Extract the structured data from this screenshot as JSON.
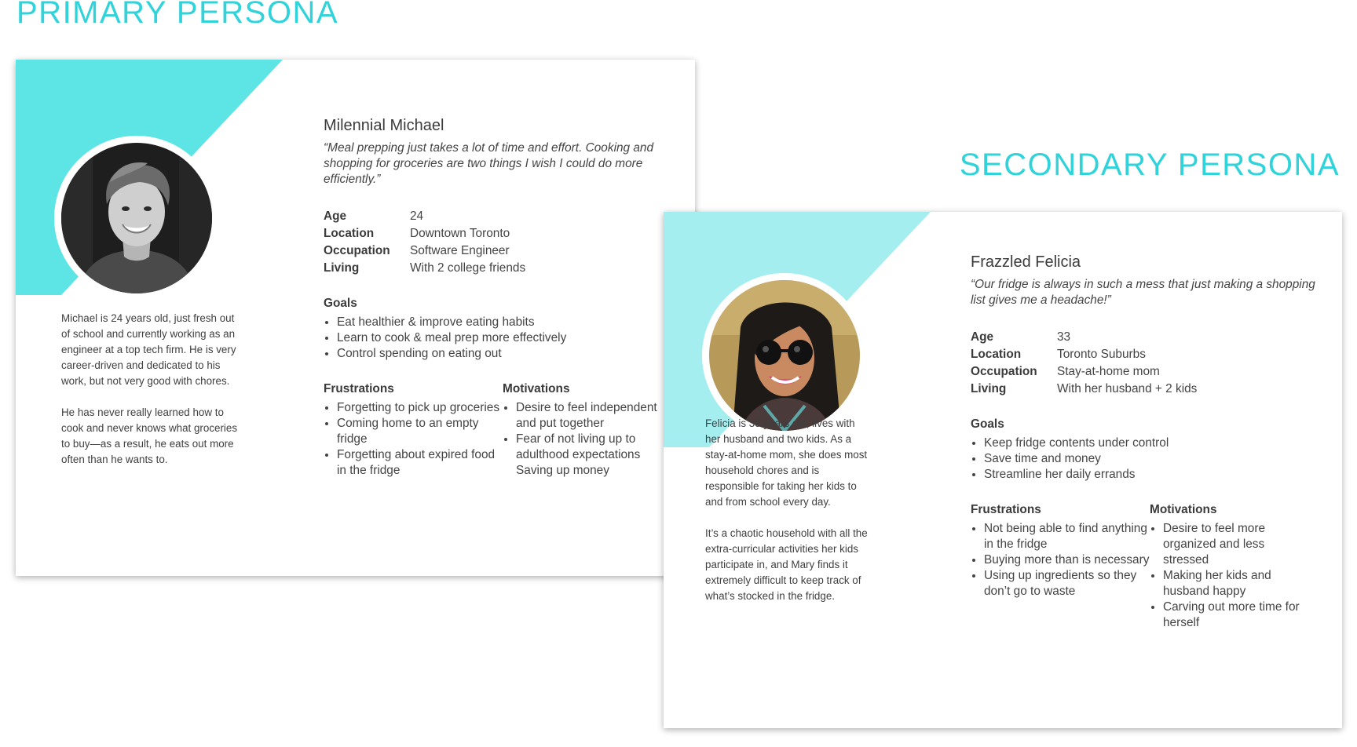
{
  "primary_title": "PRIMARY PERSONA",
  "secondary_title": "SECONDARY PERSONA",
  "colors": {
    "accent": "#2fd3d9",
    "primary_shape": "#5de4e4",
    "secondary_shape": "#a4eef0"
  },
  "primary": {
    "name": "Milennial Michael",
    "quote": "“Meal prepping just takes a lot of time and effort. Cooking and shopping for groceries are two things I wish I could do more efficiently.”",
    "bio": [
      "Michael is 24 years old, just fresh out of school and currently working as an engineer at a top tech firm. He is very career-driven and dedicated to his work, but not very good with chores.",
      "He has never really learned how to cook and never knows what groceries to buy—as a result, he eats out more often than he wants to."
    ],
    "facts": [
      {
        "label": "Age",
        "value": "24"
      },
      {
        "label": "Location",
        "value": "Downtown Toronto"
      },
      {
        "label": "Occupation",
        "value": "Software Engineer"
      },
      {
        "label": "Living",
        "value": "With 2 college friends"
      }
    ],
    "goals_heading": "Goals",
    "goals": [
      "Eat healthier & improve eating habits",
      "Learn to cook & meal prep more effectively",
      "Control spending on eating out"
    ],
    "frustrations_heading": "Frustrations",
    "frustrations": [
      "Forgetting to pick up groceries",
      "Coming home to an empty fridge",
      "Forgetting about expired food in the fridge"
    ],
    "motivations_heading": "Motivations",
    "motivations": [
      "Desire to feel independent and put together",
      "Fear of not living up to adulthood expectations Saving up money"
    ]
  },
  "secondary": {
    "name": "Frazzled Felicia",
    "quote": "“Our fridge is always in such a mess that just making a shopping list gives me a headache!”",
    "bio": [
      "Felicia is 33 years old, lives with her husband and two kids. As a stay-at-home mom, she does most household chores and is responsible for taking her kids to and from school every day.",
      "It’s a chaotic household with all the extra-curricular activities her kids participate in, and Mary finds it extremely difficult to keep track of what’s stocked in the fridge."
    ],
    "facts": [
      {
        "label": "Age",
        "value": "33"
      },
      {
        "label": "Location",
        "value": "Toronto Suburbs"
      },
      {
        "label": "Occupation",
        "value": "Stay-at-home mom"
      },
      {
        "label": "Living",
        "value": "With her husband + 2 kids"
      }
    ],
    "goals_heading": "Goals",
    "goals": [
      "Keep fridge contents under control",
      "Save time and money",
      "Streamline her daily errands"
    ],
    "frustrations_heading": "Frustrations",
    "frustrations": [
      "Not being able to find anything in the fridge",
      "Buying more than is necessary",
      "Using up ingredients so they don’t go to waste"
    ],
    "motivations_heading": "Motivations",
    "motivations": [
      "Desire to feel more organized and less stressed",
      "Making her kids and husband happy",
      "Carving out more time for herself"
    ]
  }
}
